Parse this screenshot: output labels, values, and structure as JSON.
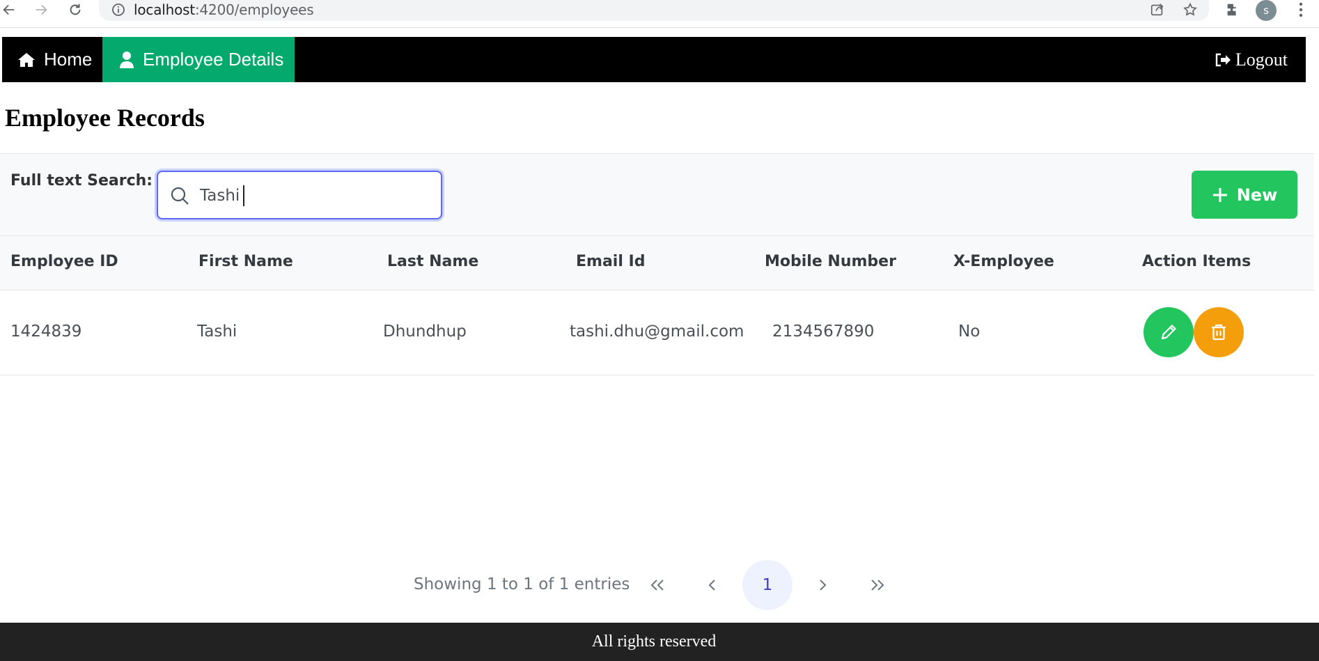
{
  "browser": {
    "url_host": "localhost",
    "url_rest": ":4200/employees",
    "profile_initial": "s"
  },
  "navbar": {
    "home_label": "Home",
    "employee_details_label": "Employee Details",
    "logout_label": "Logout",
    "active_color": "#04aa6d"
  },
  "page": {
    "title": "Employee Records"
  },
  "search": {
    "label": "Full text Search:",
    "value": "Tashi"
  },
  "toolbar": {
    "new_label": "New"
  },
  "table": {
    "columns": [
      "Employee ID",
      "First Name",
      "Last Name",
      "Email Id",
      "Mobile Number",
      "X-Employee",
      "Action Items"
    ],
    "rows": [
      {
        "employee_id": "1424839",
        "first_name": "Tashi",
        "last_name": "Dhundhup",
        "email": "tashi.dhu@gmail.com",
        "mobile": "2134567890",
        "x_employee": "No"
      }
    ]
  },
  "paginator": {
    "report": "Showing 1 to 1 of 1 entries",
    "current_page": "1"
  },
  "footer": {
    "text": "All rights reserved"
  }
}
